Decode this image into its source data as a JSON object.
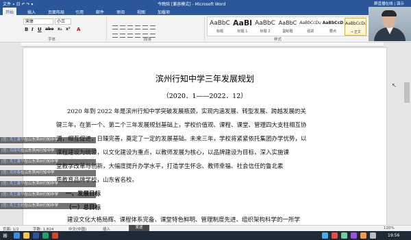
{
  "window": {
    "title": "今晚陪 [兼容模式] - Microsoft Word",
    "quick_access": "文件 ∙ 日 ↶ ↷ ▾",
    "meeting_label": "群直播在线 | 演示"
  },
  "ribbon": {
    "tabs": [
      "开始",
      "插入",
      "页面布局",
      "引用",
      "邮件",
      "审阅",
      "视图",
      "加载项"
    ],
    "active_tab": "开始",
    "font_name": "宋体",
    "font_size": "小三",
    "groups": [
      "字体",
      "段落",
      "样式"
    ],
    "format_buttons": [
      "B",
      "I",
      "U",
      "abe",
      "x₂",
      "x²",
      "A"
    ],
    "styles": [
      {
        "sample": "AaBbC",
        "name": "标题"
      },
      {
        "sample": "AaBl",
        "name": "标题 1"
      },
      {
        "sample": "AaBbC",
        "name": "标题 2"
      },
      {
        "sample": "AaBbC",
        "name": "副标题"
      },
      {
        "sample": "AaBbCcDu",
        "name": "强调"
      },
      {
        "sample": "AaBbCcD",
        "name": "要点"
      },
      {
        "sample": "AaBbCcDu",
        "name": "→ 正文"
      }
    ]
  },
  "document": {
    "title": "滨州行知中学三年发展规划",
    "date": "（2020．1——2022．12）",
    "lines": [
      "2020 年到 2022 年是滨州行知中学突破发展瓶颈，实现内涵发展、转型发展、跨越发展的关",
      "键三年，在第一个、第二个三年发展规划基础上，学校价值观、课程、课堂、管理四大支柱相互协",
      "调，相互促进，日臻完善，奠定了一定的发展基础。未来三年，学校将紧紧依托集团办学优势，以",
      "课程建设为统领，以文化建设为重点，以教师发展为核心，以品牌建设为目标，深入实施课",
      "堂教学改革与创新，大幅度提升办学水平，打造学生怀念、教师幸福、社会信任的鲁北素",
      "质教育品牌学校，山东省名校。"
    ],
    "heading_1": "一、发展目标",
    "heading_2": "（一）总目标",
    "last_line": "建设文化大格局辉、课程体系完备、课堂特色鲜明、管理制度先进、组织架构科学的一所学"
  },
  "chat": [
    {
      "who": "[医] 鸡王建华",
      "text": "在山东滨州行知中学"
    },
    {
      "who": "[医] 鸡鼎鸣",
      "text": "在山东滨州行知中学"
    },
    {
      "who": "[医] 鸡王建华",
      "text": "在山东滨州行知中学"
    },
    {
      "who": "[医] 鸡刘春",
      "text": "在山东滨州行知中学"
    },
    {
      "who": "[医] 鸡王建华",
      "text": "在山东滨州行知中学"
    },
    {
      "who": "[医] 鸡王建华",
      "text": "在山东滨州行知中学"
    },
    {
      "who": "[医] 鸡王全超",
      "text": "在山东滨州行知中学"
    }
  ],
  "statusbar": {
    "page": "页面: 1/2",
    "words": "字数: 1,824",
    "lang": "中文(中国)",
    "mode": "插入",
    "send": "发送",
    "zoom": "120%"
  },
  "taskbar": {
    "clock": "19:56"
  },
  "colors": {
    "title_bar": "#2b579a",
    "ribbon": "#f3f3f3",
    "taskbar": "#1f2a36"
  }
}
